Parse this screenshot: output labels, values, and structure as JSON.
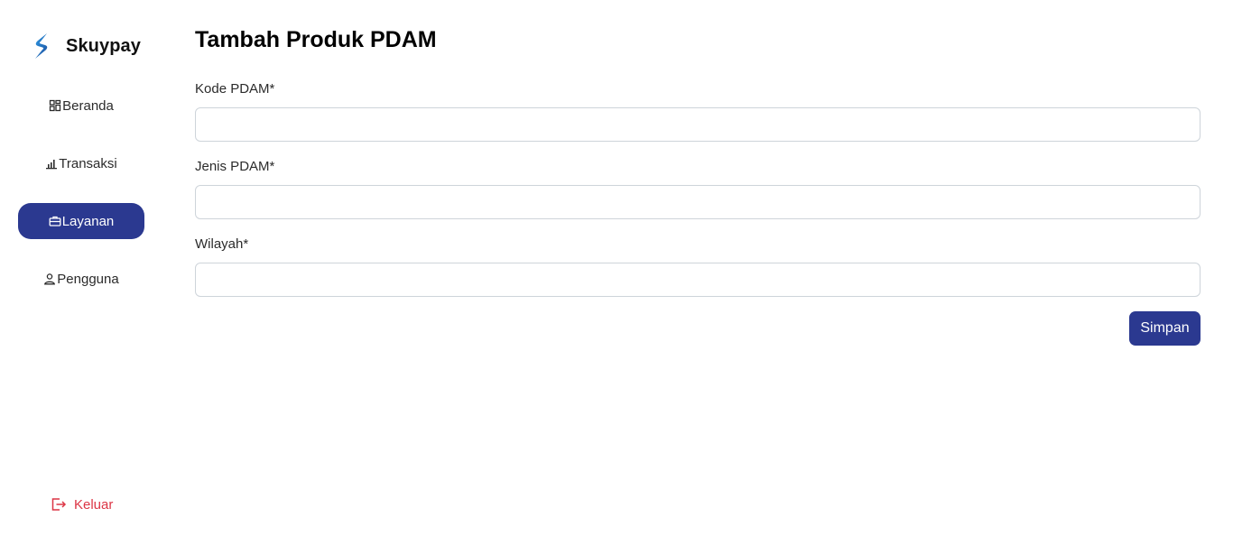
{
  "brand": {
    "name": "Skuypay",
    "logo_icon": "skuypay-logo-icon"
  },
  "sidebar": {
    "items": [
      {
        "label": "Beranda",
        "icon": "dashboard-grid-icon",
        "active": false
      },
      {
        "label": "Transaksi",
        "icon": "bar-chart-icon",
        "active": false
      },
      {
        "label": "Layanan",
        "icon": "briefcase-icon",
        "active": true
      },
      {
        "label": "Pengguna",
        "icon": "user-icon",
        "active": false
      }
    ],
    "logout": {
      "label": "Keluar",
      "icon": "logout-icon"
    }
  },
  "main": {
    "title": "Tambah Produk PDAM",
    "fields": [
      {
        "label": "Kode PDAM*",
        "value": "",
        "placeholder": ""
      },
      {
        "label": "Jenis PDAM*",
        "value": "",
        "placeholder": ""
      },
      {
        "label": "Wilayah*",
        "value": "",
        "placeholder": ""
      }
    ],
    "submit_label": "Simpan"
  },
  "colors": {
    "primary": "#2b3990",
    "danger": "#dc3545",
    "border": "#ced4da"
  }
}
